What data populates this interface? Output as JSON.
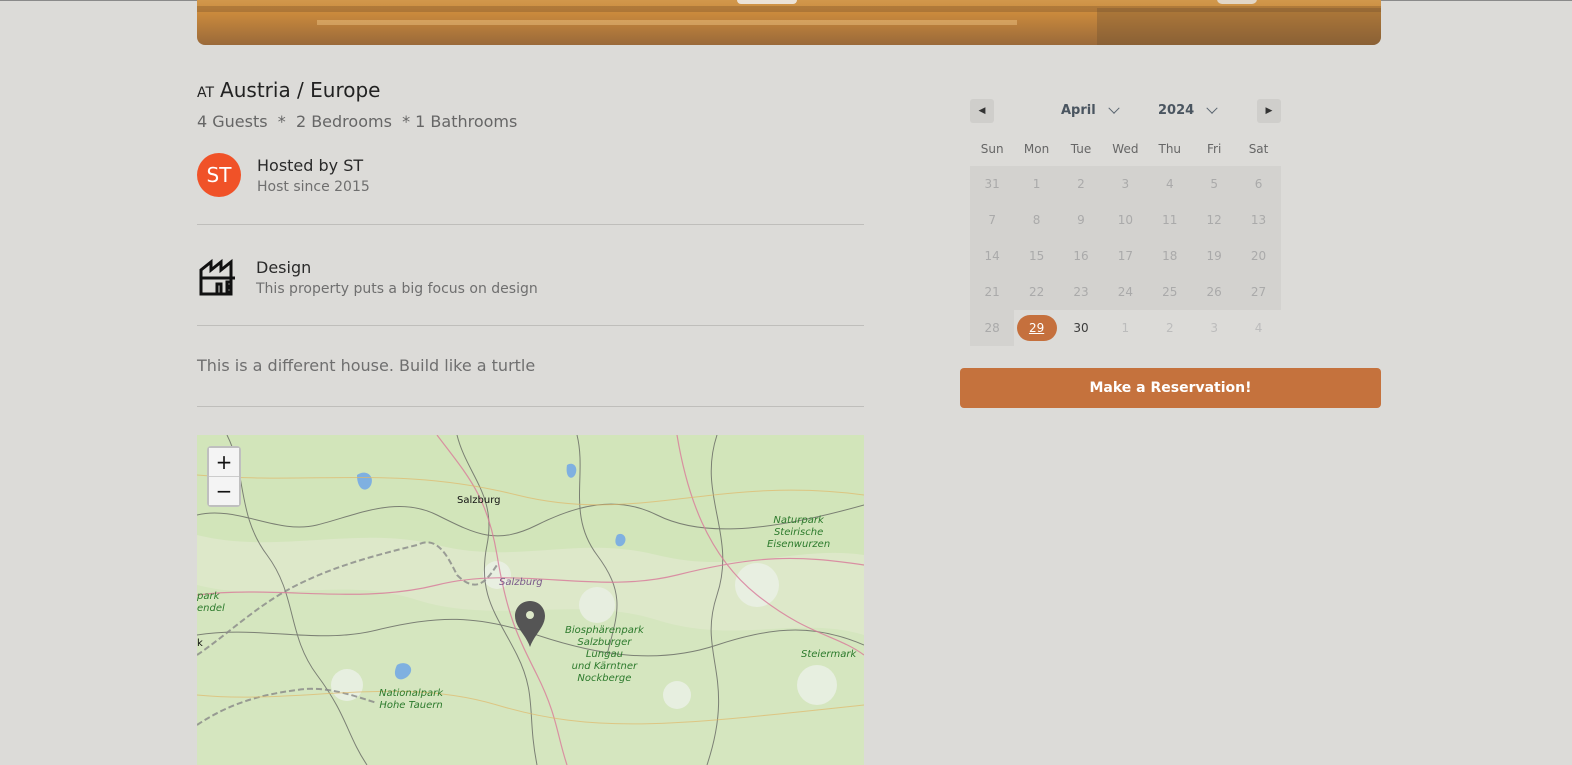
{
  "listing": {
    "country_code": "AT",
    "location": "Austria / Europe",
    "stats": "4 Guests  *  2 Bedrooms  * 1 Bathrooms",
    "host": {
      "initials": "ST",
      "name": "Hosted by ST",
      "since": "Host since 2015",
      "avatar_color": "#f05228"
    },
    "feature": {
      "icon": "building-icon",
      "title": "Design",
      "description": "This property puts a big focus on design"
    },
    "description": "This is a different house. Build like a turtle"
  },
  "map": {
    "zoom_in": "+",
    "zoom_out": "−",
    "labels": {
      "salzburg_city": "Salzburg",
      "salzburg_region": "Salzburg",
      "park_steirische": [
        "Naturpark",
        "Steirische",
        "Eisenwurzen"
      ],
      "park_lungau": [
        "Biosphärenpark",
        "Salzburger",
        "Lungau",
        "und Kärntner",
        "Nockberge"
      ],
      "park_hohe_tauern": [
        "Nationalpark",
        "Hohe Tauern"
      ],
      "steiermark": "Steiermark",
      "park_left": [
        "park",
        "endel"
      ],
      "k_left": "k"
    }
  },
  "calendar": {
    "month": "April",
    "year": "2024",
    "weekdays": [
      "Sun",
      "Mon",
      "Tue",
      "Wed",
      "Thu",
      "Fri",
      "Sat"
    ],
    "days": [
      {
        "d": "31",
        "s": "other"
      },
      {
        "d": "1",
        "s": "past"
      },
      {
        "d": "2",
        "s": "past"
      },
      {
        "d": "3",
        "s": "past"
      },
      {
        "d": "4",
        "s": "past"
      },
      {
        "d": "5",
        "s": "past"
      },
      {
        "d": "6",
        "s": "past"
      },
      {
        "d": "7",
        "s": "past"
      },
      {
        "d": "8",
        "s": "past"
      },
      {
        "d": "9",
        "s": "past"
      },
      {
        "d": "10",
        "s": "past"
      },
      {
        "d": "11",
        "s": "past"
      },
      {
        "d": "12",
        "s": "past"
      },
      {
        "d": "13",
        "s": "past"
      },
      {
        "d": "14",
        "s": "past"
      },
      {
        "d": "15",
        "s": "past"
      },
      {
        "d": "16",
        "s": "past"
      },
      {
        "d": "17",
        "s": "past"
      },
      {
        "d": "18",
        "s": "past"
      },
      {
        "d": "19",
        "s": "past"
      },
      {
        "d": "20",
        "s": "past"
      },
      {
        "d": "21",
        "s": "past"
      },
      {
        "d": "22",
        "s": "past"
      },
      {
        "d": "23",
        "s": "past"
      },
      {
        "d": "24",
        "s": "past"
      },
      {
        "d": "25",
        "s": "past"
      },
      {
        "d": "26",
        "s": "past"
      },
      {
        "d": "27",
        "s": "past"
      },
      {
        "d": "28",
        "s": "past"
      },
      {
        "d": "29",
        "s": "selected"
      },
      {
        "d": "30",
        "s": "current"
      },
      {
        "d": "1",
        "s": "next"
      },
      {
        "d": "2",
        "s": "next"
      },
      {
        "d": "3",
        "s": "next"
      },
      {
        "d": "4",
        "s": "next"
      }
    ],
    "selected_color": "#c5703d"
  },
  "reserve_button": "Make a Reservation!",
  "accent_color": "#c5723d"
}
